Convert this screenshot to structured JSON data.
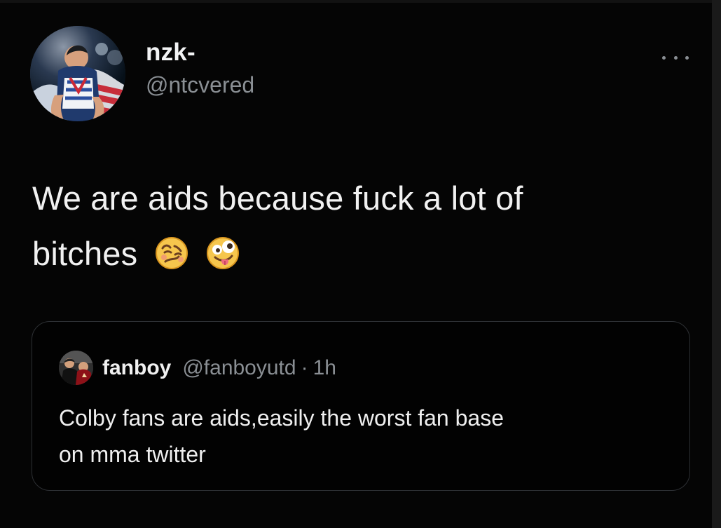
{
  "tweet": {
    "author": {
      "display_name": "nzk-",
      "handle": "@ntcvered"
    },
    "menu_icon": "more-horizontal-icon",
    "text_line_1": "We are aids because fuck a lot of",
    "text_line_2": "bitches",
    "emojis": [
      "woozy-face-emoji",
      "zany-face-emoji"
    ]
  },
  "quoted_tweet": {
    "author": {
      "display_name": "fanboy",
      "handle": "@fanboyutd"
    },
    "separator": "·",
    "time": "1h",
    "text_line_1": "Colby fans are aids,easily the worst fan base",
    "text_line_2": "on mma twitter"
  },
  "colors": {
    "background": "#000000",
    "primary_text": "#f1f1f1",
    "secondary_text": "#8a8f94",
    "border": "#2d3034"
  }
}
